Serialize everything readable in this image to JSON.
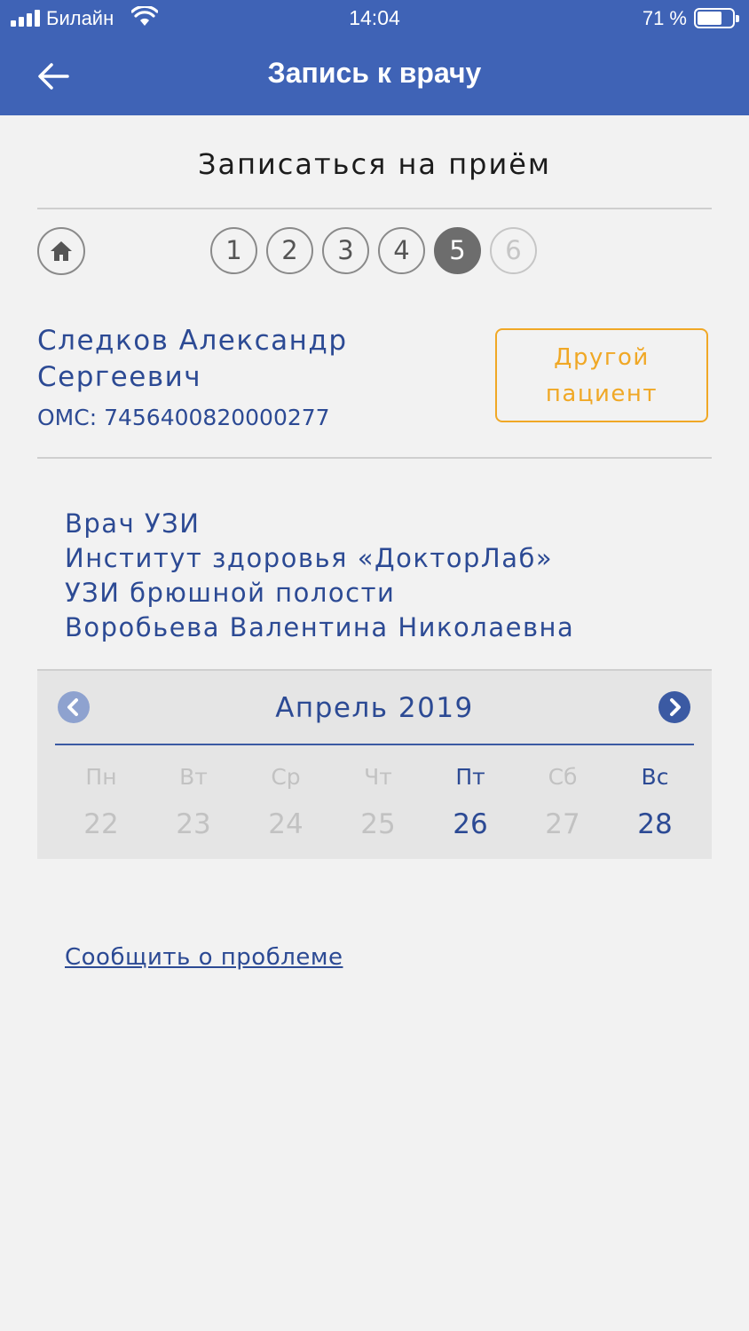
{
  "status_bar": {
    "carrier": "Билайн",
    "time": "14:04",
    "battery_percent": "71 %",
    "battery_level": 0.71
  },
  "nav": {
    "title": "Запись к врачу",
    "back_icon": "arrow-left-icon"
  },
  "page_title": "Записаться на приём",
  "steps": {
    "home_icon": "home-icon",
    "items": [
      "1",
      "2",
      "3",
      "4",
      "5",
      "6"
    ],
    "active": "5"
  },
  "patient": {
    "name_line1": "Следков Александр",
    "name_line2": "Сергеевич",
    "oms": "ОМС: 7456400820000277",
    "other_button": {
      "line1": "Другой",
      "line2": "пациент"
    }
  },
  "doctor": {
    "specialty": "Врач УЗИ",
    "clinic": "Институт здоровья «ДокторЛаб»",
    "service": "УЗИ брюшной полости",
    "name": "Воробьева Валентина Николаевна"
  },
  "calendar": {
    "month": "Апрель 2019",
    "prev_icon": "chevron-left-icon",
    "next_icon": "chevron-right-icon",
    "days": [
      {
        "dow": "Пн",
        "date": "22",
        "available": false
      },
      {
        "dow": "Вт",
        "date": "23",
        "available": false
      },
      {
        "dow": "Ср",
        "date": "24",
        "available": false
      },
      {
        "dow": "Чт",
        "date": "25",
        "available": false
      },
      {
        "dow": "Пт",
        "date": "26",
        "available": true
      },
      {
        "dow": "Сб",
        "date": "27",
        "available": false
      },
      {
        "dow": "Вс",
        "date": "28",
        "available": true
      }
    ]
  },
  "report_link": "Сообщить о проблеме",
  "colors": {
    "header_bg": "#3f63b6",
    "primary_text": "#2c4a94",
    "accent_orange": "#f0a826",
    "disabled": "#c2c2c2"
  }
}
